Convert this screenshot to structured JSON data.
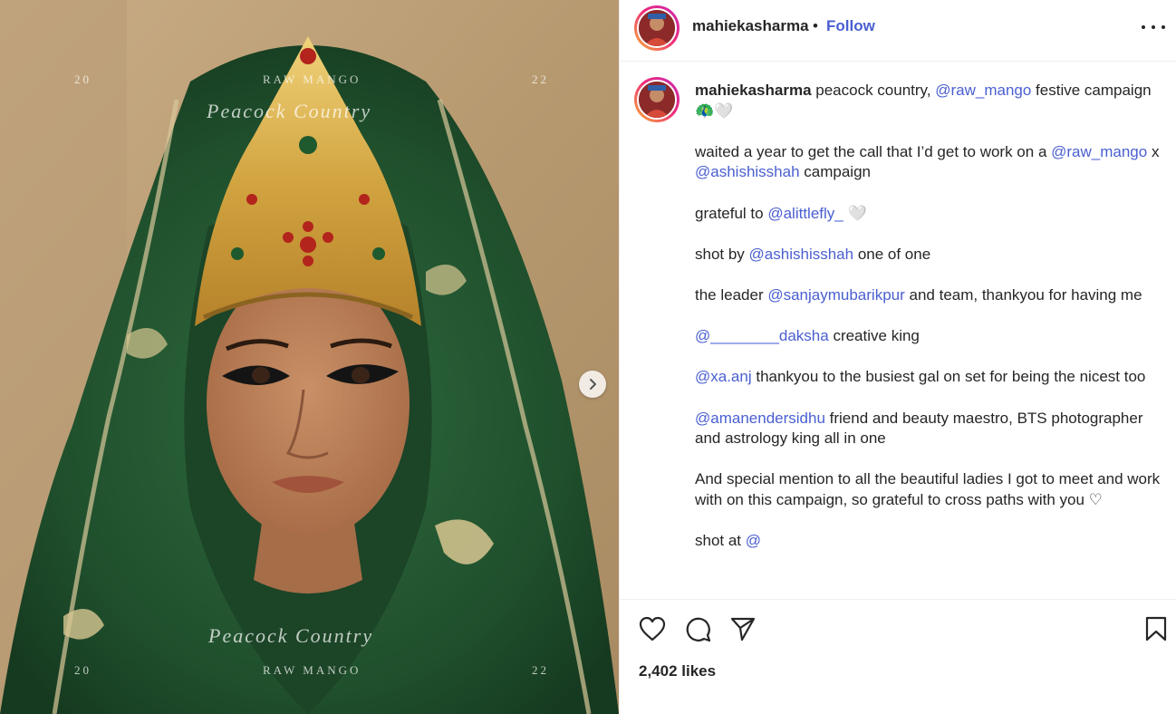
{
  "post": {
    "image_overlay": {
      "top_left_year": "20",
      "top_center_brand": "RAW MANGO",
      "top_right_year": "22",
      "top_script": "Peacock Country",
      "bottom_script": "Peacock Country",
      "bottom_left_year": "20",
      "bottom_center_brand": "RAW MANGO",
      "bottom_right_year": "22"
    },
    "next_icon": "chevron-right-icon"
  },
  "header": {
    "username": "mahiekasharma",
    "separator": "•",
    "follow_label": "Follow",
    "more_icon": "more-horizontal-icon"
  },
  "caption": {
    "author": "mahiekasharma",
    "line1_text": " peacock country, ",
    "line1_mention": "@raw_mango",
    "line1_tail": " festive campaign 🦚🤍",
    "p2_text": "waited a year to get the call that I’d get to work on a ",
    "p2_mention1": "@raw_mango",
    "p2_x": " x ",
    "p2_mention2": "@ashishisshah",
    "p2_tail": " campaign",
    "p3_text": "grateful to ",
    "p3_mention": "@alittlefly_",
    "p3_tail": " 🤍",
    "p4_text": "shot by ",
    "p4_mention": "@ashishisshah",
    "p4_tail": " one of one",
    "p5_text": "the leader ",
    "p5_mention": "@sanjaymubarikpur",
    "p5_tail": " and team, thankyou for having me",
    "p6_mention": "@________daksha",
    "p6_tail": " creative king",
    "p7_mention": "@xa.anj",
    "p7_tail": " thankyou to the busiest gal on set for being the nicest too",
    "p8_mention": "@amanendersidhu",
    "p8_tail": " friend and beauty maestro, BTS photographer and astrology king all in one",
    "p9_text": "And special mention to all the beautiful ladies I got to meet and work with on this campaign, so grateful to cross paths with you ♡",
    "p10_text": "shot at ",
    "p10_mention": "@"
  },
  "actions": {
    "like_icon": "heart-icon",
    "comment_icon": "comment-icon",
    "share_icon": "send-icon",
    "save_icon": "bookmark-icon",
    "likes_text": "2,402 likes"
  },
  "colors": {
    "mention": "#4a5fd1",
    "text": "#262626",
    "border": "#efefef",
    "story_ring_start": "#f9b233",
    "story_ring_end": "#c72bb5"
  }
}
